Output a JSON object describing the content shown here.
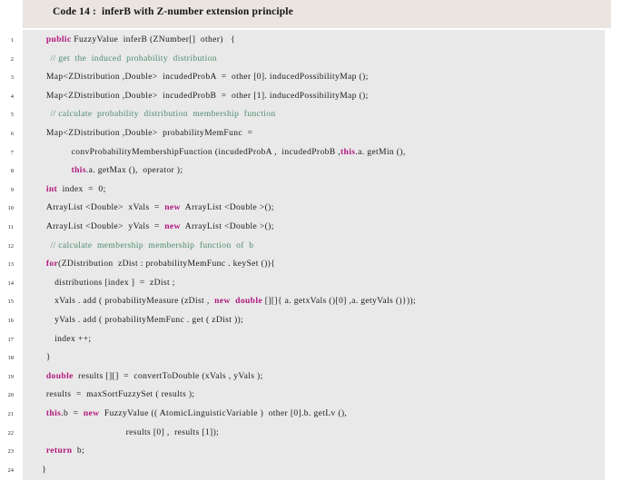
{
  "figure": {
    "caption": "Code 14 :  inferB with Z-number extension principle",
    "caption_bg": "#ebe5e1",
    "code_bg": "#e9e9e9",
    "keyword_color": "#b1177d",
    "comment_color": "#4e8c6e",
    "text_color": "#1a1a1a",
    "language": "java"
  },
  "code": {
    "line_numbers": [
      "1",
      "2",
      "3",
      "4",
      "5",
      "6",
      "7",
      "8",
      "9",
      "10",
      "11",
      "12",
      "13",
      "14",
      "15",
      "16",
      "17",
      "18",
      "19",
      "20",
      "21",
      "22",
      "23",
      "24"
    ],
    "lines": [
      {
        "n": "1",
        "indent": 3,
        "tokens": [
          {
            "t": "public",
            "k": "kw"
          },
          {
            "t": " FuzzyValue  inferB (ZNumber[]  other)   {",
            "k": "pln"
          }
        ]
      },
      {
        "n": "2",
        "indent": 4,
        "tokens": [
          {
            "t": "// get  the  induced  probability  distribution",
            "k": "cmt"
          }
        ]
      },
      {
        "n": "3",
        "indent": 3,
        "tokens": [
          {
            "t": "Map<ZDistribution ,Double>  incudedProbA  =  other [0]. inducedPossibilityMap ();",
            "k": "pln"
          }
        ]
      },
      {
        "n": "4",
        "indent": 3,
        "tokens": [
          {
            "t": "Map<ZDistribution ,Double>  incudedProbB  =  other [1]. inducedPossibilityMap ();",
            "k": "pln"
          }
        ]
      },
      {
        "n": "5",
        "indent": 4,
        "tokens": [
          {
            "t": "// calculate  probability  distribution  membership  function",
            "k": "cmt"
          }
        ]
      },
      {
        "n": "6",
        "indent": 3,
        "tokens": [
          {
            "t": "Map<ZDistribution ,Double>  probabilityMemFunc  =",
            "k": "pln"
          }
        ]
      },
      {
        "n": "7",
        "indent": 9,
        "tokens": [
          {
            "t": "convProbabilityMembershipFunction (incudedProbA ,  incudedProbB ,",
            "k": "pln"
          },
          {
            "t": "this",
            "k": "kw"
          },
          {
            "t": ".a. getMin (),",
            "k": "pln"
          }
        ]
      },
      {
        "n": "8",
        "indent": 9,
        "tokens": [
          {
            "t": "this",
            "k": "kw"
          },
          {
            "t": ".a. getMax (),  operator );",
            "k": "pln"
          }
        ]
      },
      {
        "n": "9",
        "indent": 3,
        "tokens": [
          {
            "t": "int",
            "k": "kw"
          },
          {
            "t": "  index  =  0;",
            "k": "pln"
          }
        ]
      },
      {
        "n": "10",
        "indent": 3,
        "tokens": [
          {
            "t": "ArrayList <Double>  xVals  =  ",
            "k": "pln"
          },
          {
            "t": "new",
            "k": "kw"
          },
          {
            "t": "  ArrayList <Double >();",
            "k": "pln"
          }
        ]
      },
      {
        "n": "11",
        "indent": 3,
        "tokens": [
          {
            "t": "ArrayList <Double>  yVals  =  ",
            "k": "pln"
          },
          {
            "t": "new",
            "k": "kw"
          },
          {
            "t": "  ArrayList <Double >();",
            "k": "pln"
          }
        ]
      },
      {
        "n": "12",
        "indent": 4,
        "tokens": [
          {
            "t": "// calculate  membership  membership  function  of  b",
            "k": "cmt"
          }
        ]
      },
      {
        "n": "13",
        "indent": 3,
        "tokens": [
          {
            "t": "for",
            "k": "kw"
          },
          {
            "t": "(ZDistribution  zDist : probabilityMemFunc . keySet ()){",
            "k": "pln"
          }
        ]
      },
      {
        "n": "14",
        "indent": 5,
        "tokens": [
          {
            "t": "distributions [index ]  =  zDist ;",
            "k": "pln"
          }
        ]
      },
      {
        "n": "15",
        "indent": 5,
        "tokens": [
          {
            "t": "xVals . add ( probabilityMeasure (zDist ,  ",
            "k": "pln"
          },
          {
            "t": "new  double",
            "k": "kw"
          },
          {
            "t": " [][]{ a. getxVals ()[0] ,a. getyVals ()}));",
            "k": "pln"
          }
        ]
      },
      {
        "n": "16",
        "indent": 5,
        "tokens": [
          {
            "t": "yVals . add ( probabilityMemFunc . get ( zDist ));",
            "k": "pln"
          }
        ]
      },
      {
        "n": "17",
        "indent": 5,
        "tokens": [
          {
            "t": "index ++;",
            "k": "pln"
          }
        ]
      },
      {
        "n": "18",
        "indent": 3,
        "tokens": [
          {
            "t": "}",
            "k": "pln"
          }
        ]
      },
      {
        "n": "19",
        "indent": 3,
        "tokens": [
          {
            "t": "double",
            "k": "kw"
          },
          {
            "t": "  results [][]  =  convertToDouble (xVals , yVals );",
            "k": "pln"
          }
        ]
      },
      {
        "n": "20",
        "indent": 3,
        "tokens": [
          {
            "t": "results  =  maxSortFuzzySet ( results );",
            "k": "pln"
          }
        ]
      },
      {
        "n": "21",
        "indent": 3,
        "tokens": [
          {
            "t": "this",
            "k": "kw"
          },
          {
            "t": ".b  =  ",
            "k": "pln"
          },
          {
            "t": "new",
            "k": "kw"
          },
          {
            "t": "  FuzzyValue (( AtomicLinguisticVariable )  other [0].b. getLv (),",
            "k": "pln"
          }
        ]
      },
      {
        "n": "22",
        "indent": 22,
        "tokens": [
          {
            "t": "results [0] ,  results [1]);",
            "k": "pln"
          }
        ]
      },
      {
        "n": "23",
        "indent": 3,
        "tokens": [
          {
            "t": "return",
            "k": "kw"
          },
          {
            "t": "  b;",
            "k": "pln"
          }
        ]
      },
      {
        "n": "24",
        "indent": 2,
        "tokens": [
          {
            "t": "}",
            "k": "pln"
          }
        ]
      }
    ]
  }
}
